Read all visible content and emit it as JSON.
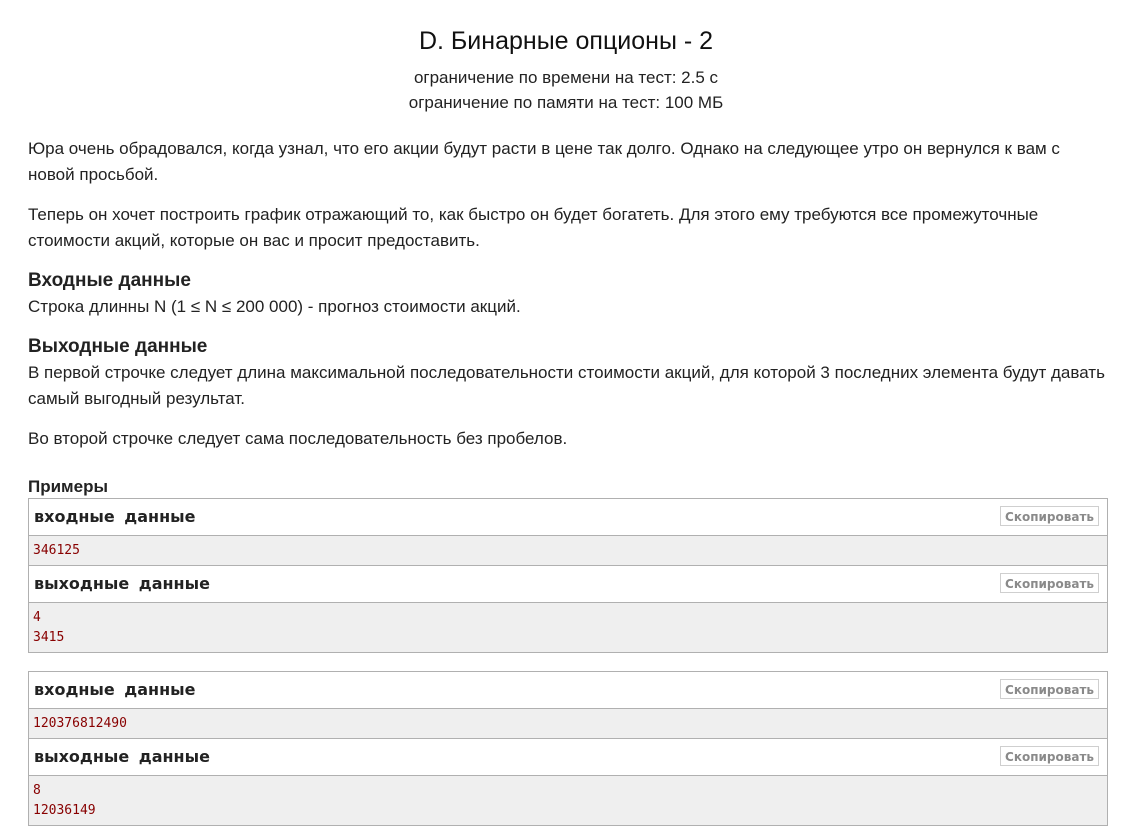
{
  "problem": {
    "title": "D. Бинарные опционы - 2",
    "time_limit": "ограничение по времени на тест: 2.5 с",
    "memory_limit": "ограничение по памяти на тест: 100 МБ"
  },
  "statement": {
    "p1": "Юра очень обрадовался, когда узнал, что его акции будут расти в цене так долго. Однако на следующее утро он вернулся к вам с новой просьбой.",
    "p2": "Теперь он хочет построить график отражающий то, как быстро он будет богатеть. Для этого ему требуются все промежуточные стоимости акций, которые он вас и просит предоставить."
  },
  "input_section": {
    "title": "Входные данные",
    "text": "Строка длинны N (1 ≤ N ≤ 200 000) - прогноз стоимости акций."
  },
  "output_section": {
    "title": "Выходные данные",
    "text1": "В первой строчке следует длина максимальной последовательности стоимости акций, для которой 3 последних элемента будут давать самый выгодный результат.",
    "text2": "Во второй строчке следует сама последовательность без пробелов."
  },
  "examples": {
    "title": "Примеры",
    "input_label": "входные данные",
    "output_label": "выходные данные",
    "copy_label": "Скопировать",
    "items": [
      {
        "input": [
          "346125"
        ],
        "output": [
          "4",
          "3415"
        ]
      },
      {
        "input": [
          "120376812490"
        ],
        "output": [
          "8",
          "12036149"
        ]
      }
    ]
  }
}
